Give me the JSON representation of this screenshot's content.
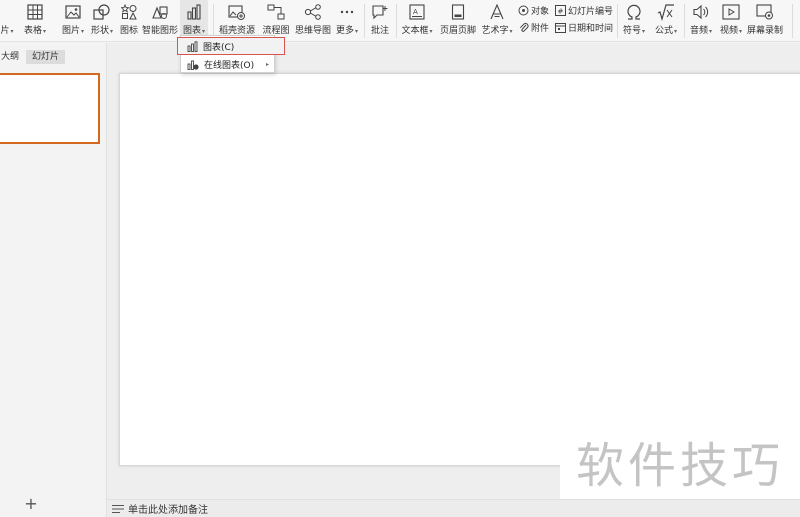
{
  "ribbon": {
    "items": [
      {
        "id": "picture-partial",
        "label": "片",
        "dd": "▾"
      },
      {
        "id": "table",
        "label": "表格",
        "dd": "▾"
      },
      {
        "id": "image",
        "label": "图片",
        "dd": "▾"
      },
      {
        "id": "shape",
        "label": "形状",
        "dd": "▾"
      },
      {
        "id": "icon",
        "label": "图标",
        "dd": ""
      },
      {
        "id": "smartart",
        "label": "智能图形",
        "dd": ""
      },
      {
        "id": "chart",
        "label": "图表",
        "dd": "▾"
      },
      {
        "id": "shell-resource",
        "label": "稻壳资源",
        "dd": ""
      },
      {
        "id": "flowchart",
        "label": "流程图",
        "dd": ""
      },
      {
        "id": "mindmap",
        "label": "思维导图",
        "dd": ""
      },
      {
        "id": "more",
        "label": "更多",
        "dd": "▾"
      },
      {
        "id": "comment",
        "label": "批注",
        "dd": ""
      },
      {
        "id": "textbox",
        "label": "文本框",
        "dd": "▾"
      },
      {
        "id": "header-footer",
        "label": "页眉页脚",
        "dd": ""
      },
      {
        "id": "wordart",
        "label": "艺术字",
        "dd": "▾"
      },
      {
        "id": "symbol",
        "label": "符号",
        "dd": "▾"
      },
      {
        "id": "formula",
        "label": "公式",
        "dd": "▾"
      },
      {
        "id": "audio",
        "label": "音频",
        "dd": "▾"
      },
      {
        "id": "video",
        "label": "视频",
        "dd": "▾"
      },
      {
        "id": "screen-record",
        "label": "屏幕录制",
        "dd": ""
      }
    ],
    "object": "对象",
    "attachment": "附件",
    "slide_number": "幻灯片编号",
    "date_time": "日期和时间"
  },
  "panel": {
    "tab_outline": "大纲",
    "tab_slides": "幻灯片",
    "add": "+"
  },
  "menu": {
    "chart": "图表(C)",
    "online_chart": "在线图表(O)",
    "arrow": "▸"
  },
  "notes": {
    "placeholder": "单击此处添加备注"
  },
  "watermark": "软件技巧"
}
